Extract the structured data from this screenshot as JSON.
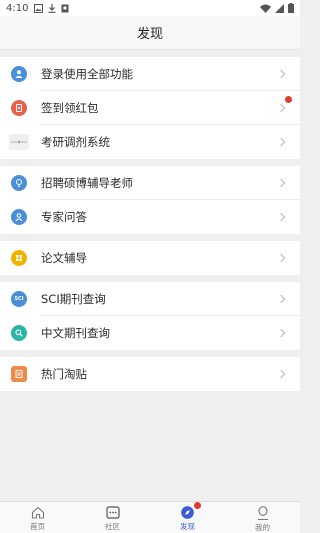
{
  "status_bar": {
    "time": "4:10",
    "left_icons": [
      "image-icon",
      "download-icon",
      "app-icon"
    ],
    "right_icons": [
      "wifi-icon",
      "signal-icon",
      "battery-icon"
    ]
  },
  "header": {
    "title": "发现"
  },
  "groups": [
    {
      "items": [
        {
          "label": "登录使用全部功能",
          "icon": "user-icon",
          "color": "#4a90d9",
          "badge": false
        },
        {
          "label": "签到领红包",
          "icon": "redpacket-icon",
          "color": "#e8604c",
          "badge": true
        },
        {
          "label": "考研调剂系统",
          "icon": "system-icon",
          "color": "#c8c8c8",
          "badge": false
        }
      ]
    },
    {
      "items": [
        {
          "label": "招聘硕博辅导老师",
          "icon": "bulb-icon",
          "color": "#4a90d9",
          "badge": false
        },
        {
          "label": "专家问答",
          "icon": "expert-icon",
          "color": "#4a90d9",
          "badge": false
        }
      ]
    },
    {
      "items": [
        {
          "label": "论文辅导",
          "icon": "paper-icon",
          "color": "#f0b400",
          "badge": false
        }
      ]
    },
    {
      "items": [
        {
          "label": "SCI期刊查询",
          "icon": "sci-icon",
          "color": "#4a90d9",
          "badge": false
        },
        {
          "label": "中文期刊查询",
          "icon": "magnifier-icon",
          "color": "#2bb5a5",
          "badge": false
        }
      ]
    },
    {
      "items": [
        {
          "label": "热门淘贴",
          "icon": "hot-post-icon",
          "color": "#f08a4b",
          "badge": false
        }
      ]
    }
  ],
  "icon_text": {
    "sci": "SCI"
  },
  "bottom_nav": [
    {
      "label": "首页",
      "icon": "home-icon",
      "active": false,
      "badge": false
    },
    {
      "label": "社区",
      "icon": "community-icon",
      "active": false,
      "badge": false
    },
    {
      "label": "发现",
      "icon": "discover-icon",
      "active": true,
      "badge": true
    },
    {
      "label": "我的",
      "icon": "profile-icon",
      "active": false,
      "badge": false
    }
  ],
  "colors": {
    "accent": "#3a5bd6",
    "badge": "#e23a2e"
  }
}
